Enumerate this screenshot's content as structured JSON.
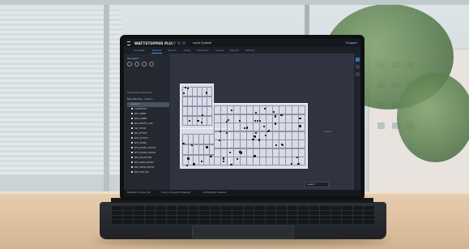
{
  "app": {
    "brand": "WATTSTOPPER PLUS",
    "location": "Local System",
    "support": "Support"
  },
  "tabs": [
    {
      "label": "Live View"
    },
    {
      "label": "Devices"
    },
    {
      "label": "Sensors"
    },
    {
      "label": "Areas"
    },
    {
      "label": "Schedules"
    },
    {
      "label": "Scenes"
    },
    {
      "label": "Reports"
    },
    {
      "label": "Settings"
    }
  ],
  "sidebar": {
    "title": "Navigator",
    "tabs_label": "Select Items    Selections",
    "items": [
      {
        "label": "Main Building · Level 1"
      },
      {
        "label": "Level 1"
      },
      {
        "label": "CORRIDOR"
      },
      {
        "label": "NE_LOBBY"
      },
      {
        "label": "NW_LOBBY"
      },
      {
        "label": "NE_NORTH_COR"
      },
      {
        "label": "SW_STAIR"
      },
      {
        "label": "NE_OFFICE"
      },
      {
        "label": "NW_OFFICE"
      },
      {
        "label": "NTS_BANK"
      },
      {
        "label": "NTS_EXCEL_ROOM"
      },
      {
        "label": "NTS_EXCEL_ROOM"
      },
      {
        "label": "NEI_JOB_ROOM"
      },
      {
        "label": "NEI_MAIN_ROOM"
      },
      {
        "label": "NEI_OPEN_ROOM"
      },
      {
        "label": "NEI_FILE_RM"
      }
    ]
  },
  "canvas": {
    "side_label": "Level 1",
    "legend": "Legend"
  },
  "status": {
    "left": "Bluetooth: Online (14)",
    "middle": "Cloud: Connection Disabled",
    "right": "Configuration Session"
  },
  "colors": {
    "accent": "#4f8ff7",
    "canvas_bg": "#2f3440",
    "floorplan": "#d9dbe6"
  }
}
